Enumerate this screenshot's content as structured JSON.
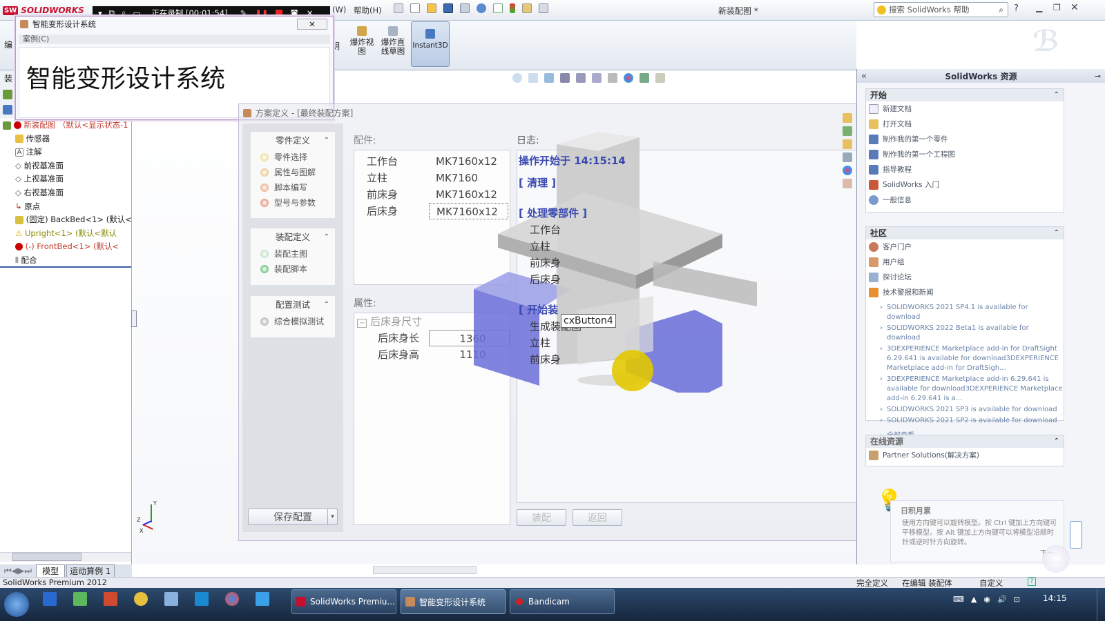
{
  "app": {
    "logo": "SOLIDWORKS",
    "doc_title": "新装配图 *",
    "menu_items": [
      "(W)",
      "帮助(H)"
    ],
    "search_placeholder": "搜索 SolidWorks 帮助"
  },
  "recorder": {
    "status": "正在录制 [00:01:54]"
  },
  "ribbon": {
    "left_labels": [
      "编",
      "装"
    ],
    "partial_label": "明",
    "buttons": [
      {
        "label": "爆炸视图"
      },
      {
        "label": "爆炸直线草图"
      },
      {
        "label": "Instant3D"
      }
    ]
  },
  "splash": {
    "window_title": "智能变形设计系统",
    "menu": "案例(C)",
    "heading": "智能变形设计系统"
  },
  "tree": {
    "root": "新装配图 （默认<显示状态-1",
    "items": [
      {
        "label": "传感器"
      },
      {
        "label": "注解"
      },
      {
        "label": "前视基准面"
      },
      {
        "label": "上视基准面"
      },
      {
        "label": "右视基准面"
      },
      {
        "label": "原点"
      },
      {
        "label": "(固定) BackBed<1> (默认<"
      },
      {
        "label": "Upright<1> (默认<默认"
      },
      {
        "label": "(-) FrontBed<1> (默认<"
      },
      {
        "label": "配合"
      }
    ],
    "tabs": [
      "模型",
      "运动算例 1"
    ]
  },
  "dialog": {
    "title": "方案定义 - [最终装配方案]",
    "groups": [
      {
        "title": "零件定义",
        "items": [
          "零件选择",
          "属性与图解",
          "脚本编写",
          "型号与参数"
        ]
      },
      {
        "title": "装配定义",
        "items": [
          "装配主图",
          "装配脚本"
        ]
      },
      {
        "title": "配置测试",
        "items": [
          "综合模拟测试"
        ]
      }
    ],
    "save_button": "保存配置",
    "parts_label": "配件:",
    "parts": [
      {
        "name": "工作台",
        "model": "MK7160x12"
      },
      {
        "name": "立柱",
        "model": "MK7160"
      },
      {
        "name": "前床身",
        "model": "MK7160x12"
      },
      {
        "name": "后床身",
        "model": "MK7160x12"
      }
    ],
    "props_label": "属性:",
    "prop_group": "后床身尺寸",
    "props": [
      {
        "name": "后床身长",
        "value": "1360"
      },
      {
        "name": "后床身高",
        "value": "1110"
      }
    ],
    "log_label": "日志:",
    "log": [
      "操作开始于 14:15:14",
      "[ 清理 ]",
      "[ 处理零部件 ]",
      "工作台",
      "立柱",
      "前床身",
      "后床身",
      "[ 开始装",
      "生成装配图",
      "立柱",
      "前床身"
    ],
    "tooltip": "cxButton4",
    "assemble_button": "装配",
    "back_button": "返回"
  },
  "taskpane": {
    "title": "SolidWorks 资源",
    "start_title": "开始",
    "start_items": [
      "新建文档",
      "打开文档",
      "制作我的第一个零件",
      "制作我的第一个工程图",
      "指导教程",
      "SolidWorks 入门",
      "一般信息"
    ],
    "community_title": "社区",
    "community_items": [
      "客户门户",
      "用户组",
      "探讨论坛",
      "技术警报和新闻"
    ],
    "news": [
      "SOLIDWORKS 2021 SP4.1 is available for download",
      "SOLIDWORKS 2022 Beta1 is available for download",
      "3DEXPERIENCE Marketplace add-in for DraftSight 6.29.641 is available for download3DEXPERIENCE Marketplace add-in for DraftSigh...",
      "3DEXPERIENCE Marketplace add-in 6.29.641 is available for download3DEXPERIENCE Marketplace add-in 6.29.641 is a...",
      "SOLIDWORKS 2021 SP3 is available for download",
      "SOLIDWORKS 2021 SP2 is available for download"
    ],
    "see_all": "全部查看",
    "online_title": "在线资源",
    "online_items": [
      "Partner Solutions(解决方案)"
    ],
    "tip_title": "日积月累",
    "tip_text": "使用方向键可以旋转模型。按 Ctrl 键加上方向键可平移模型。按 Alt 键加上方向键可以将模型沿顺时针或逆时针方向旋转。",
    "tip_next": "下一"
  },
  "status": {
    "left": "SolidWorks Premium 2012",
    "items": [
      "完全定义",
      "在编辑 装配体",
      "自定义"
    ]
  },
  "taskbar": {
    "windows": [
      "SolidWorks Premiu...",
      "智能变形设计系统",
      "Bandicam"
    ],
    "clock": "14:15"
  },
  "colors": {
    "accent": "#3a49b0",
    "model_blue": "#6b6fd8",
    "brand_red": "#c8102e"
  }
}
